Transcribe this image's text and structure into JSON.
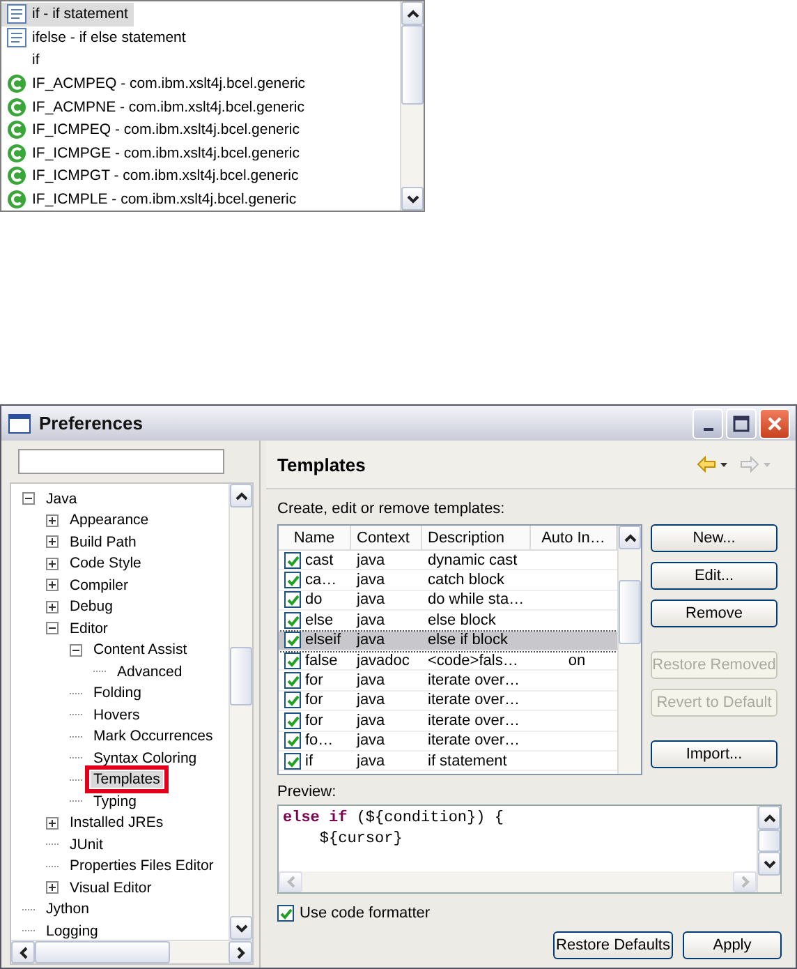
{
  "completion_popup": {
    "items": [
      {
        "kind": "template",
        "label": "if - if statement",
        "selected": true
      },
      {
        "kind": "template",
        "label": "ifelse  - if else statement",
        "selected": false
      },
      {
        "kind": "keyword",
        "label": "if",
        "selected": false
      },
      {
        "kind": "class",
        "label": "IF_ACMPEQ - com.ibm.xslt4j.bcel.generic",
        "selected": false
      },
      {
        "kind": "class",
        "label": "IF_ACMPNE - com.ibm.xslt4j.bcel.generic",
        "selected": false
      },
      {
        "kind": "class",
        "label": "IF_ICMPEQ - com.ibm.xslt4j.bcel.generic",
        "selected": false
      },
      {
        "kind": "class",
        "label": "IF_ICMPGE - com.ibm.xslt4j.bcel.generic",
        "selected": false
      },
      {
        "kind": "class",
        "label": "IF_ICMPGT - com.ibm.xslt4j.bcel.generic",
        "selected": false
      },
      {
        "kind": "class",
        "label": "IF_ICMPLE - com.ibm.xslt4j.bcel.generic",
        "selected": false
      }
    ]
  },
  "window": {
    "title": "Preferences"
  },
  "tree": [
    {
      "label": "Java",
      "expanded": true,
      "selected": false,
      "children": [
        {
          "label": "Appearance",
          "expanded": false,
          "selected": false
        },
        {
          "label": "Build Path",
          "expanded": false,
          "selected": false
        },
        {
          "label": "Code Style",
          "expanded": false,
          "selected": false
        },
        {
          "label": "Compiler",
          "expanded": false,
          "selected": false
        },
        {
          "label": "Debug",
          "expanded": false,
          "selected": false
        },
        {
          "label": "Editor",
          "expanded": true,
          "selected": false,
          "children": [
            {
              "label": "Content Assist",
              "expanded": true,
              "selected": false,
              "children": [
                {
                  "label": "Advanced",
                  "selected": false
                }
              ]
            },
            {
              "label": "Folding",
              "selected": false
            },
            {
              "label": "Hovers",
              "selected": false
            },
            {
              "label": "Mark Occurrences",
              "selected": false
            },
            {
              "label": "Syntax Coloring",
              "selected": false
            },
            {
              "label": "Templates",
              "selected": true
            },
            {
              "label": "Typing",
              "selected": false
            }
          ]
        },
        {
          "label": "Installed JREs",
          "expanded": false,
          "selected": false
        },
        {
          "label": "JUnit",
          "selected": false
        },
        {
          "label": "Properties Files Editor",
          "selected": false
        },
        {
          "label": "Visual Editor",
          "expanded": false,
          "selected": false
        }
      ]
    },
    {
      "label": "Jython",
      "selected": false
    },
    {
      "label": "Logging",
      "selected": false
    }
  ],
  "page": {
    "title": "Templates",
    "back": {
      "disabled": false
    },
    "forward": {
      "disabled": true
    }
  },
  "table_label": "Create, edit or remove templates:",
  "table": {
    "columns": [
      "Name",
      "Context",
      "Description",
      "Auto In…"
    ],
    "rows": [
      {
        "name": "cast",
        "context": "java",
        "description": "dynamic cast",
        "auto_insert": "",
        "checked": true,
        "selected": false
      },
      {
        "name": "ca…",
        "context": "java",
        "description": "catch block",
        "auto_insert": "",
        "checked": true,
        "selected": false
      },
      {
        "name": "do",
        "context": "java",
        "description": "do while sta…",
        "auto_insert": "",
        "checked": true,
        "selected": false
      },
      {
        "name": "else",
        "context": "java",
        "description": "else block",
        "auto_insert": "",
        "checked": true,
        "selected": false
      },
      {
        "name": "elseif",
        "context": "java",
        "description": "else if block",
        "auto_insert": "",
        "checked": true,
        "selected": true
      },
      {
        "name": "false",
        "context": "javadoc",
        "description": "<code>fals…",
        "auto_insert": "on",
        "checked": true,
        "selected": false
      },
      {
        "name": "for",
        "context": "java",
        "description": "iterate over…",
        "auto_insert": "",
        "checked": true,
        "selected": false
      },
      {
        "name": "for",
        "context": "java",
        "description": "iterate over…",
        "auto_insert": "",
        "checked": true,
        "selected": false
      },
      {
        "name": "for",
        "context": "java",
        "description": "iterate over…",
        "auto_insert": "",
        "checked": true,
        "selected": false
      },
      {
        "name": "fo…",
        "context": "java",
        "description": "iterate over…",
        "auto_insert": "",
        "checked": true,
        "selected": false
      },
      {
        "name": "if",
        "context": "java",
        "description": "if statement",
        "auto_insert": "",
        "checked": true,
        "selected": false
      }
    ]
  },
  "buttons": [
    {
      "label": "New...",
      "disabled": false,
      "gap": false
    },
    {
      "label": "Edit...",
      "disabled": false,
      "gap": false
    },
    {
      "label": "Remove",
      "disabled": false,
      "gap": false
    },
    {
      "label": "Restore Removed",
      "disabled": true,
      "gap": true
    },
    {
      "label": "Revert to Default",
      "disabled": true,
      "gap": false
    },
    {
      "label": "Import...",
      "disabled": false,
      "gap": true
    }
  ],
  "preview": {
    "label": "Preview:",
    "lines": [
      [
        {
          "kind": "keyword",
          "text": "else if"
        },
        {
          "kind": "plain",
          "text": " (${condition}) {"
        }
      ],
      [
        {
          "kind": "plain",
          "text": "    ${cursor}"
        }
      ]
    ]
  },
  "use_code_formatter": {
    "label": "Use code formatter",
    "checked": true
  },
  "footer_buttons": [
    "Restore Defaults",
    "Apply"
  ]
}
